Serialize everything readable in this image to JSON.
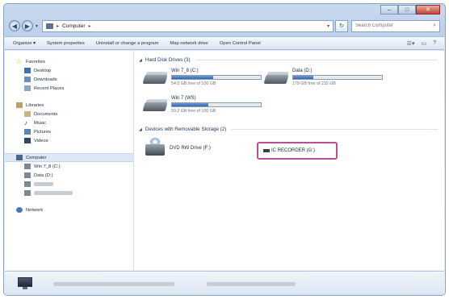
{
  "window": {
    "caption_buttons": [
      "–",
      "□",
      "✕"
    ]
  },
  "address_bar": {
    "breadcrumb_root": "Computer",
    "separator": "▸",
    "dropdown": "▾",
    "refresh_icon": "↻",
    "search_placeholder": "Search Computer"
  },
  "toolbar": {
    "organize": "Organize ▾",
    "system_properties": "System properties",
    "uninstall": "Uninstall or change a program",
    "map_network": "Map network drive",
    "control_panel": "Open Control Panel",
    "view_icon": "☰▾",
    "pane_icon": "▭",
    "help_icon": "?"
  },
  "nav_pane": {
    "favorites": {
      "label": "Favorites",
      "items": [
        "Desktop",
        "Downloads",
        "Recent Places"
      ]
    },
    "libraries": {
      "label": "Libraries",
      "items": [
        "Documents",
        "Music",
        "Pictures",
        "Videos"
      ]
    },
    "computer": {
      "label": "Computer",
      "items": [
        "Win 7_8 (C:)",
        "Data (D:)"
      ]
    },
    "network": {
      "label": "Network"
    }
  },
  "content": {
    "hard_disk_header": "Hard Disk Drives (3)",
    "removable_header": "Devices with Removable Storage (2)",
    "drives": [
      {
        "name": "Win 7_8 (C:)",
        "free": "54.0 GB free of 100 GB",
        "fill": 0.46
      },
      {
        "name": "Data (D:)",
        "free": "179 GB free of 232 GB",
        "fill": 0.23
      },
      {
        "name": "Win 7 (WS)",
        "free": "59.2 GB free of 100 GB",
        "fill": 0.41
      }
    ],
    "dvd": {
      "name": "DVD RW Drive (F:)"
    },
    "usb": {
      "name": "IC RECORDER (G:)"
    }
  },
  "colors": {
    "highlight_border": "#b84f94",
    "bar_fill": "#2f66b5"
  }
}
